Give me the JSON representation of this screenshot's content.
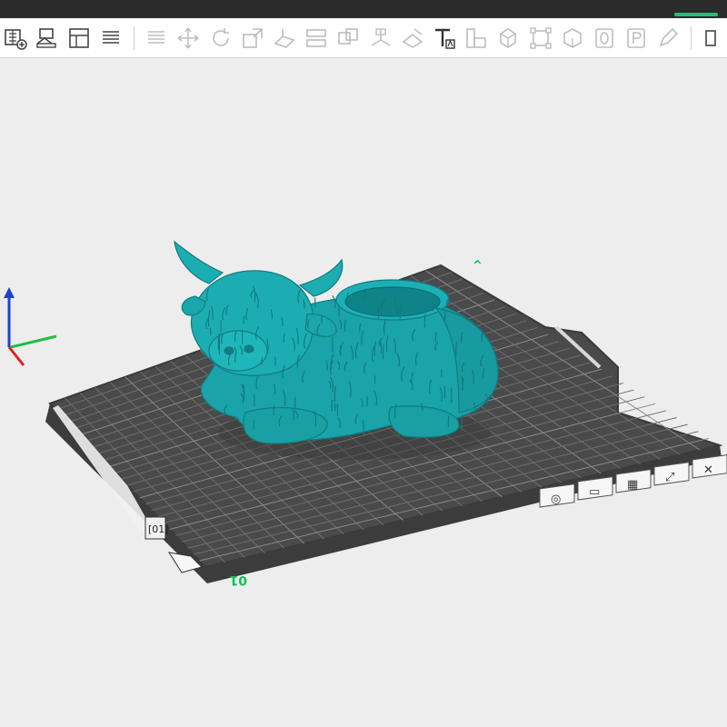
{
  "colors": {
    "background": "#ededed",
    "plate": "#4a4a4a",
    "grid": "#6a6a6a",
    "model": "#1aa3a8",
    "axis_x": "#e02020",
    "axis_y": "#20c040",
    "axis_z": "#2040d0",
    "label_green": "#10c050"
  },
  "toolbar": {
    "tools": [
      {
        "name": "add-plate-icon",
        "enabled": true
      },
      {
        "name": "arrange-icon",
        "enabled": true
      },
      {
        "name": "orient-icon",
        "enabled": true
      },
      {
        "name": "layout-icon",
        "enabled": true
      },
      {
        "name": "list-icon",
        "enabled": false
      },
      {
        "name": "move-icon",
        "enabled": false
      },
      {
        "name": "rotate-icon",
        "enabled": false
      },
      {
        "name": "scale-icon",
        "enabled": false
      },
      {
        "name": "lay-on-face-icon",
        "enabled": false
      },
      {
        "name": "cut-icon",
        "enabled": false
      },
      {
        "name": "split-icon",
        "enabled": false
      },
      {
        "name": "support-paint-icon",
        "enabled": false
      },
      {
        "name": "seam-paint-icon",
        "enabled": false
      },
      {
        "name": "text-icon",
        "enabled": true
      },
      {
        "name": "measure-icon",
        "enabled": false
      },
      {
        "name": "cube-icon",
        "enabled": false
      },
      {
        "name": "boolean-icon",
        "enabled": false
      },
      {
        "name": "brim-icon",
        "enabled": false
      },
      {
        "name": "plate-number-icon",
        "enabled": false
      },
      {
        "name": "plate-p-icon",
        "enabled": false
      },
      {
        "name": "pen-icon",
        "enabled": false
      },
      {
        "name": "more-icon",
        "enabled": true
      }
    ]
  },
  "plate": {
    "number_label": "01",
    "left_tag": "[01]",
    "top_label": "^"
  },
  "plate_buttons": [
    {
      "name": "plate-settings-button",
      "glyph": "◎"
    },
    {
      "name": "plate-lock-button",
      "glyph": "▭"
    },
    {
      "name": "plate-arrange-button",
      "glyph": "▦"
    },
    {
      "name": "plate-orient-button",
      "glyph": "⤢"
    },
    {
      "name": "plate-delete-button",
      "glyph": "✕"
    }
  ]
}
